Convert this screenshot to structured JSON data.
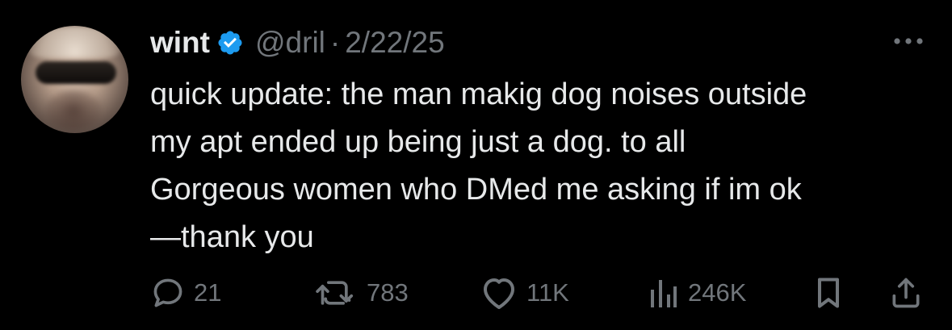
{
  "author": {
    "name": "wint",
    "handle": "@dril",
    "separator": "·",
    "date": "2/22/25",
    "verified": true,
    "verified_color": "#1d9bf0"
  },
  "tweet": {
    "lines": [
      "quick update: the man makig dog noises outside",
      "my apt ended up being just a dog. to all",
      "Gorgeous women who DMed me asking if im ok",
      "—thank you"
    ]
  },
  "actions": {
    "replies": "21",
    "retweets": "783",
    "likes": "11K",
    "views": "246K"
  },
  "icons": {
    "more": "more-options-icon",
    "reply": "reply-icon",
    "retweet": "retweet-icon",
    "like": "heart-icon",
    "views": "views-chart-icon",
    "bookmark": "bookmark-icon",
    "share": "share-icon"
  },
  "colors": {
    "background": "#000000",
    "text": "#e7e9ea",
    "muted": "#71767b",
    "accent": "#1d9bf0"
  }
}
